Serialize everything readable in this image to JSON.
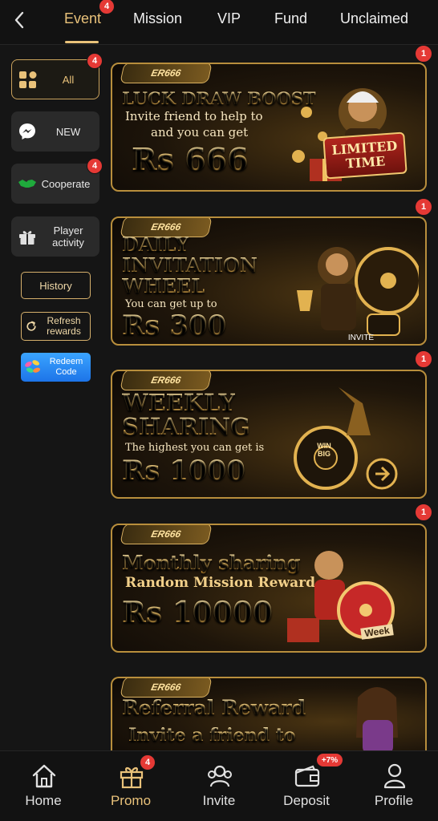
{
  "tabs": [
    {
      "label": "Event",
      "badge": "4",
      "active": true
    },
    {
      "label": "Mission"
    },
    {
      "label": "VIP"
    },
    {
      "label": "Fund"
    },
    {
      "label": "Unclaimed"
    }
  ],
  "sidebar": {
    "items": [
      {
        "label": "All",
        "badge": "4",
        "icon": "grid-icon"
      },
      {
        "label": "NEW",
        "icon": "messenger-icon"
      },
      {
        "label": "Cooperate",
        "badge": "4",
        "icon": "handshake-icon"
      },
      {
        "label": "Player activity",
        "icon": "gift-icon"
      }
    ],
    "history_label": "History",
    "refresh_label": "Refresh rewards",
    "redeem_label": "Redeem Code"
  },
  "banners": [
    {
      "logo": "ER666",
      "badge": "1",
      "title": "LUCK DRAW BOOST",
      "line1": "Invite friend to help to",
      "line2": "and you can get",
      "amount": "Rs 666",
      "tag": "LIMITED TIME"
    },
    {
      "logo": "ER666",
      "badge": "1",
      "title1": "DAILY",
      "title2": "INVITATION",
      "title3": "WHEEL",
      "line1": "You can get up to",
      "amount": "Rs 300",
      "tag": "INVITE"
    },
    {
      "logo": "ER666",
      "badge": "1",
      "title1": "WEEKLY",
      "title2": "SHARING",
      "line1": "The highest you can get is",
      "amount": "Rs 1000",
      "tag": "WIN BIG"
    },
    {
      "logo": "ER666",
      "badge": "1",
      "title1": "Monthly sharing",
      "line1": "Random Mission Reward",
      "amount": "Rs 10000",
      "tag": "Week"
    },
    {
      "logo": "ER666",
      "title1": "Referral Reward",
      "line1": "Invite a friend to"
    }
  ],
  "bottom_nav": [
    {
      "label": "Home",
      "icon": "home-icon"
    },
    {
      "label": "Promo",
      "icon": "gift-icon",
      "badge": "4",
      "active": true
    },
    {
      "label": "Invite",
      "icon": "people-icon"
    },
    {
      "label": "Deposit",
      "icon": "wallet-icon",
      "badge": "+7%"
    },
    {
      "label": "Profile",
      "icon": "person-icon"
    }
  ],
  "colors": {
    "accent": "#e9c27a",
    "badge": "#e53935",
    "background": "#151515"
  }
}
